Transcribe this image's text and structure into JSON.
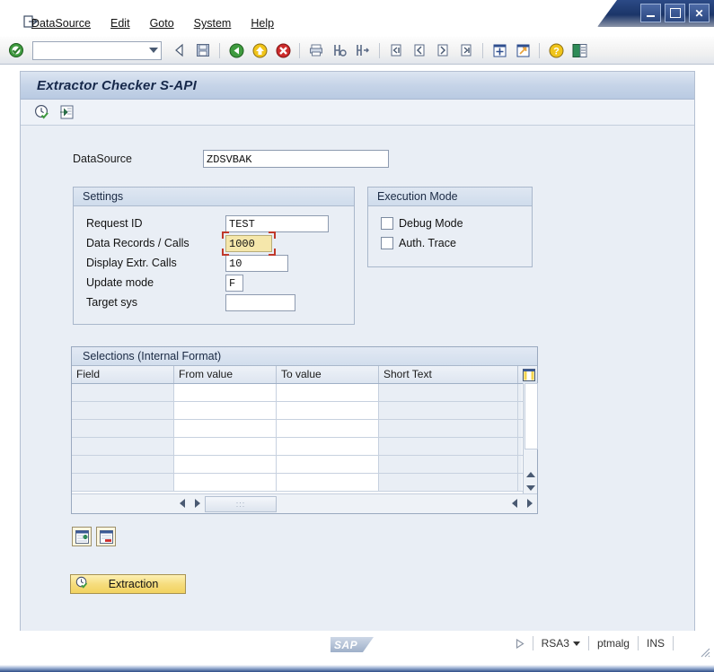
{
  "window": {
    "minimize_label": "Minimize",
    "maximize_label": "Maximize",
    "close_label": "Close"
  },
  "menubar": {
    "exit_icon": "exit-icon",
    "items": [
      {
        "label": "DataSource",
        "accel": "D"
      },
      {
        "label": "Edit",
        "accel": "E"
      },
      {
        "label": "Goto",
        "accel": "G"
      },
      {
        "label": "System",
        "accel": "y"
      },
      {
        "label": "Help",
        "accel": "H"
      }
    ]
  },
  "toolbar": {
    "command_value": "",
    "command_placeholder": "",
    "icons": [
      "enter-check-icon",
      "back-arrow-icon",
      "save-icon",
      "exit-green-icon",
      "cancel-yellow-icon",
      "stop-red-icon",
      "print-icon",
      "find-icon",
      "find-next-icon",
      "first-page-icon",
      "previous-page-icon",
      "next-page-icon",
      "last-page-icon",
      "create-session-icon",
      "create-shortcut-icon",
      "help-icon",
      "customize-layout-icon"
    ]
  },
  "screen": {
    "title": "Extractor Checker S-API",
    "app_toolbar": [
      "execute-clock-icon",
      "export-green-icon"
    ]
  },
  "datasource": {
    "label": "DataSource",
    "value": "ZDSVBAK"
  },
  "settings": {
    "legend": "Settings",
    "fields": [
      {
        "label": "Request ID",
        "value": "TEST",
        "focused": false
      },
      {
        "label": "Data Records / Calls",
        "value": "1000",
        "focused": true
      },
      {
        "label": "Display Extr. Calls",
        "value": "10",
        "focused": false
      },
      {
        "label": "Update mode",
        "value": "F",
        "focused": false
      },
      {
        "label": "Target sys",
        "value": "",
        "focused": false
      }
    ]
  },
  "execution_mode": {
    "legend": "Execution Mode",
    "options": [
      {
        "label": "Debug Mode",
        "checked": false
      },
      {
        "label": "Auth. Trace",
        "checked": false
      }
    ]
  },
  "selections": {
    "legend": "Selections (Internal Format)",
    "config_icon": "column-config-icon",
    "columns": [
      "Field",
      "From value",
      "To value",
      "Short Text"
    ],
    "rows": [
      {
        "field": "",
        "from": "",
        "to": "",
        "short_text": ""
      },
      {
        "field": "",
        "from": "",
        "to": "",
        "short_text": ""
      },
      {
        "field": "",
        "from": "",
        "to": "",
        "short_text": ""
      },
      {
        "field": "",
        "from": "",
        "to": "",
        "short_text": ""
      },
      {
        "field": "",
        "from": "",
        "to": "",
        "short_text": ""
      },
      {
        "field": "",
        "from": "",
        "to": "",
        "short_text": ""
      }
    ],
    "hscroll_thumb_label": ":::"
  },
  "row_actions": [
    {
      "name": "insert-row-button",
      "icon": "insert-row-icon"
    },
    {
      "name": "delete-row-button",
      "icon": "delete-row-icon"
    }
  ],
  "extraction_button": {
    "label": "Extraction",
    "icon": "execute-clock-icon"
  },
  "statusbar": {
    "logo": "SAP",
    "servicing_indicator": "play-triangle-icon",
    "transaction": "RSA3",
    "system": "ptmalg",
    "insert_mode": "INS",
    "grip": "resize-grip-icon"
  },
  "colors": {
    "accent_blue": "#2c4a86",
    "panel_bg": "#e9eef5",
    "focus_field_bg": "#f5e7ab",
    "focus_bracket": "#c0392b",
    "button_gold": "#f2d35f"
  }
}
